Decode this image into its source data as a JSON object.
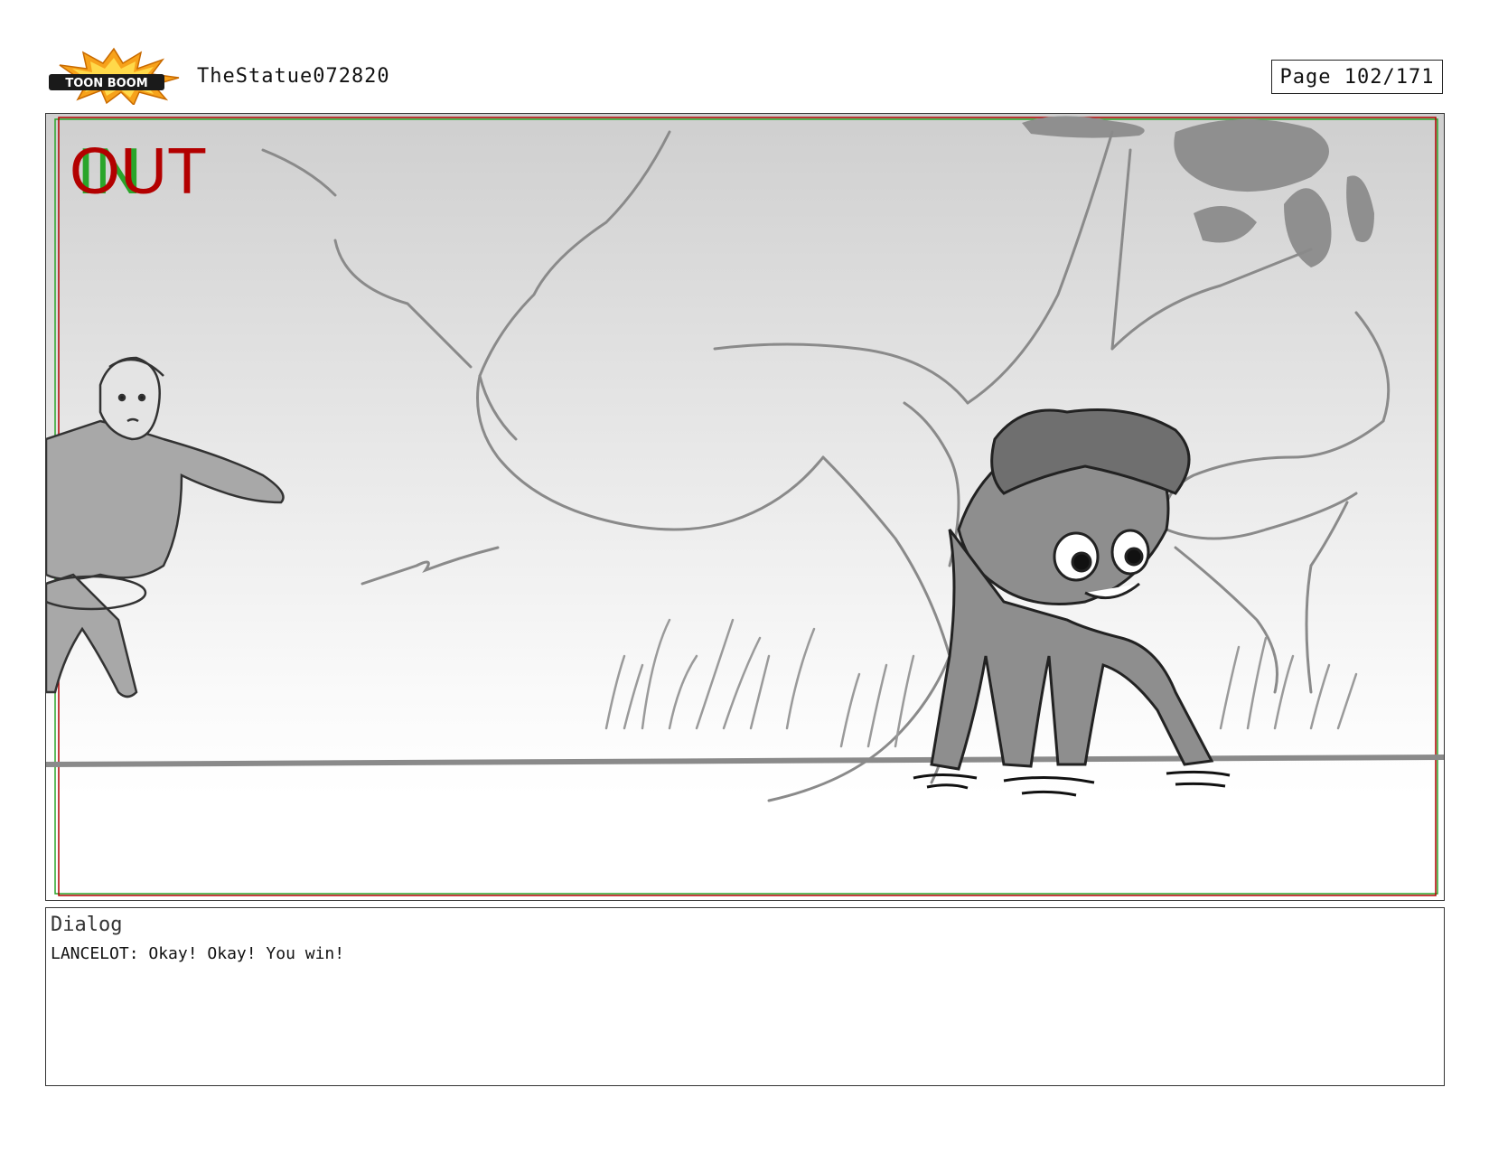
{
  "header": {
    "logo_text": "TOON BOOM",
    "document_title": "TheStatue072820",
    "page_label": "Page 102/171"
  },
  "panel": {
    "marker_in": "IN",
    "marker_out": "OUT",
    "colors": {
      "in_marker": "#2aa52a",
      "out_marker": "#b30000",
      "sketch": "#8a8a8a",
      "fill": "#9a9a9a"
    }
  },
  "dialog": {
    "heading": "Dialog",
    "line": "LANCELOT: Okay! Okay! You win!"
  }
}
